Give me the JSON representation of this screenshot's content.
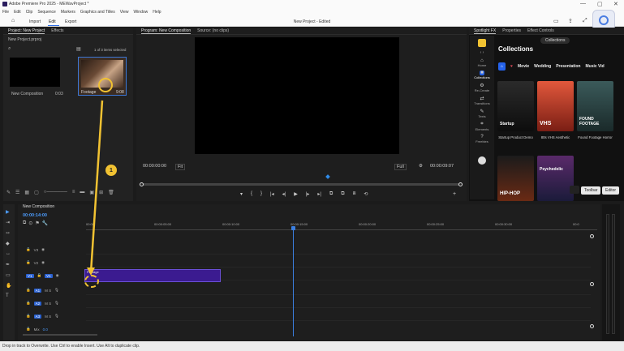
{
  "window": {
    "title": "Adobe Premiere Pro 2025 - MEWavProject *",
    "controls": [
      "—",
      "▢",
      "✕"
    ]
  },
  "menu": [
    "File",
    "Edit",
    "Clip",
    "Sequence",
    "Markers",
    "Graphics and Titles",
    "View",
    "Window",
    "Help"
  ],
  "app_tabs": {
    "home_icon": "home-icon",
    "tabs": [
      "Import",
      "Edit",
      "Export"
    ],
    "active": "Edit",
    "doc_title": "New Project - Edited"
  },
  "project_panel": {
    "tabs": [
      "Project: New Project",
      "Effects"
    ],
    "project_file": "New Project.prproj",
    "selection_status": "1 of 3 items selected",
    "items": [
      {
        "name": "New Composition",
        "duration": "0:03"
      },
      {
        "name": "Footage",
        "duration": "9:08"
      }
    ]
  },
  "program_monitor": {
    "tabs": [
      "Program: New Composition",
      "Source: (no clips)"
    ],
    "timecode_in": "00:00:00:00",
    "zoom": "Fit",
    "quality": "Full",
    "timecode_out": "00:00:09:07",
    "transport_buttons": [
      "▾",
      "{",
      "}",
      "|◂",
      "◂|",
      "▶",
      "|▸",
      "▸|",
      "⧉",
      "⧉",
      "⧈",
      "⟲",
      "+"
    ]
  },
  "spotlight_panel": {
    "tabs": [
      "Spotlight FX",
      "Properties",
      "Effect Controls"
    ],
    "nav": [
      {
        "label": "Home",
        "icon": "home-icon"
      },
      {
        "label": "Collections",
        "icon": "collections-icon"
      },
      {
        "label": "Re-Create",
        "icon": "recreate-icon"
      },
      {
        "label": "Transitions",
        "icon": "transitions-icon"
      },
      {
        "label": "Texts",
        "icon": "text-icon"
      },
      {
        "label": "Elements",
        "icon": "elements-icon"
      },
      {
        "label": "Freebies",
        "icon": "freebies-icon"
      }
    ],
    "collections_pill": "Collections",
    "title": "Collections",
    "categories": [
      "Movie",
      "Wedding",
      "Presentation",
      "Music Vid"
    ],
    "cards": [
      {
        "label": "Startup",
        "caption": "Startup Product Demo",
        "color": "#1a1a1a"
      },
      {
        "label": "VHS",
        "caption": "80s VHS Aesthetic",
        "color": "#c0422b"
      },
      {
        "label": "FOUND FOOTAGE",
        "caption": "Found Footage Horror",
        "color": "#294243"
      }
    ],
    "cards2": [
      {
        "label": "HIP-HOP",
        "color": "#5a1b10"
      },
      {
        "label": "Psychedelic",
        "color": "#3b1b4a"
      }
    ],
    "toolbar_button": "Toolbar",
    "editor_button": "Editor"
  },
  "timeline": {
    "tab": "New Composition",
    "timecode": "00:00:14:00",
    "ruler": [
      "00:00",
      "00:00:05:00",
      "00:00:10:00",
      "00:00:15:00",
      "00:00:20:00",
      "00:00:25:00",
      "00:00:30:00",
      "00:0"
    ],
    "video_tracks": [
      "V3",
      "V2",
      "V1"
    ],
    "audio_tracks": [
      "A1",
      "A2",
      "A3"
    ],
    "mix_label": "Mix",
    "mix_value": "0.0",
    "clip_label": "Footage"
  },
  "annotation": {
    "step": "1",
    "color": "#f1c232"
  },
  "status_message": "Drop in track to Overwrite. Use Ctrl to enable Insert. Use Alt to duplicate clip."
}
